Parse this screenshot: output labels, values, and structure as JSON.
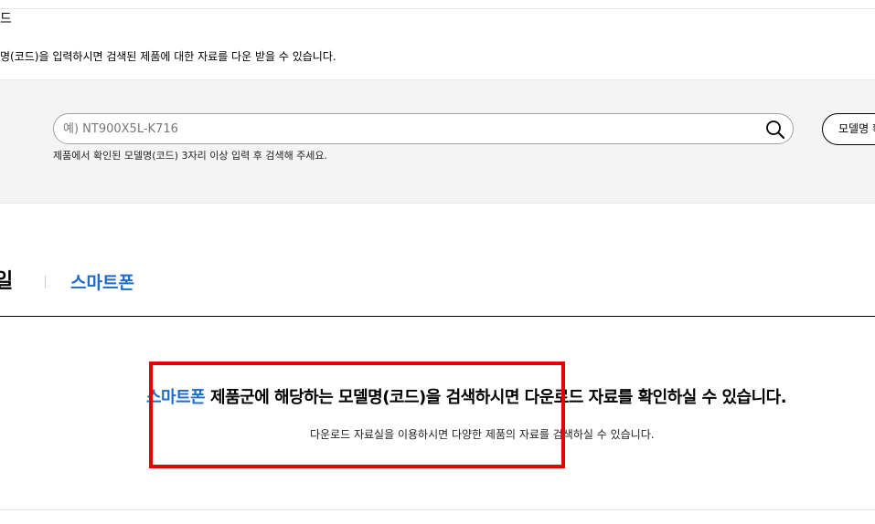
{
  "header": {
    "title_partial": "드",
    "description": "명(코드)을 입력하시면 검색된 제품에 대한 자료를 다운 받을 수 있습니다."
  },
  "search": {
    "placeholder": "예) NT900X5L-K716",
    "value": "",
    "hint": "제품에서 확인된 모델명(코드) 3자리 이상 입력 후 검색해 주세요.",
    "icon": "search-icon",
    "model_button_label": "모델명 확"
  },
  "tabs": [
    {
      "label": "일",
      "active": false
    },
    {
      "label": "스마트폰",
      "active": true
    }
  ],
  "result": {
    "heading_accent": "스마트폰",
    "heading_rest": " 제품군에 해당하는 모델명(코드)을 검색하시면 다운로드 자료를 확인하실 수 있습니다.",
    "subtext": "다운로드 자료실을 이용하시면 다양한 제품의 자료를 검색하실 수 있습니다."
  },
  "colors": {
    "accent_blue": "#1e6cc8",
    "highlight_red": "#e60000",
    "band_gray": "#f4f4f4"
  }
}
